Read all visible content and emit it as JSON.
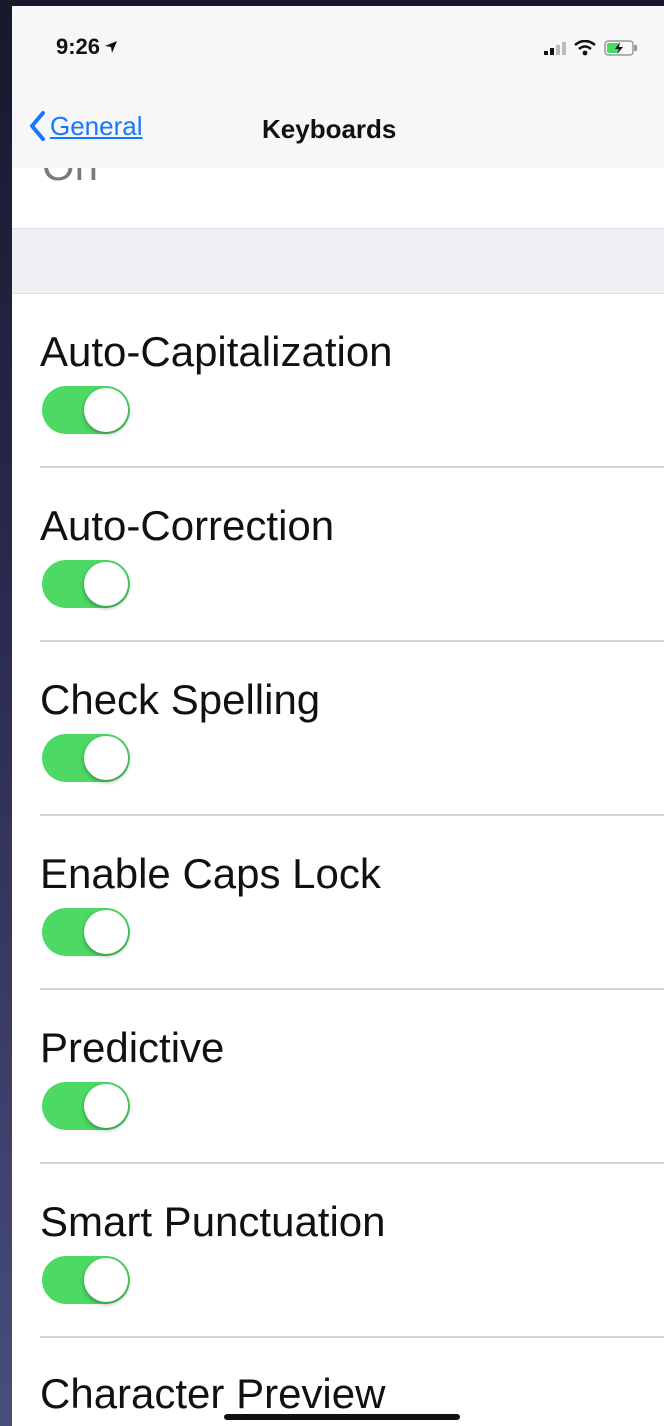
{
  "status_bar": {
    "time": "9:26",
    "icons": [
      "location-arrow-icon",
      "signal-icon",
      "wifi-icon",
      "battery-charging-icon"
    ]
  },
  "nav": {
    "back_label": "General",
    "title": "Keyboards"
  },
  "previous_row_partial_text": "On",
  "settings": [
    {
      "label": "Auto-Capitalization",
      "enabled": true
    },
    {
      "label": "Auto-Correction",
      "enabled": true
    },
    {
      "label": "Check Spelling",
      "enabled": true
    },
    {
      "label": "Enable Caps Lock",
      "enabled": true
    },
    {
      "label": "Predictive",
      "enabled": true
    },
    {
      "label": "Smart Punctuation",
      "enabled": true
    }
  ],
  "last_row_label": "Character Preview",
  "colors": {
    "toggle_on": "#4cd964",
    "link_blue": "#1677ff"
  }
}
